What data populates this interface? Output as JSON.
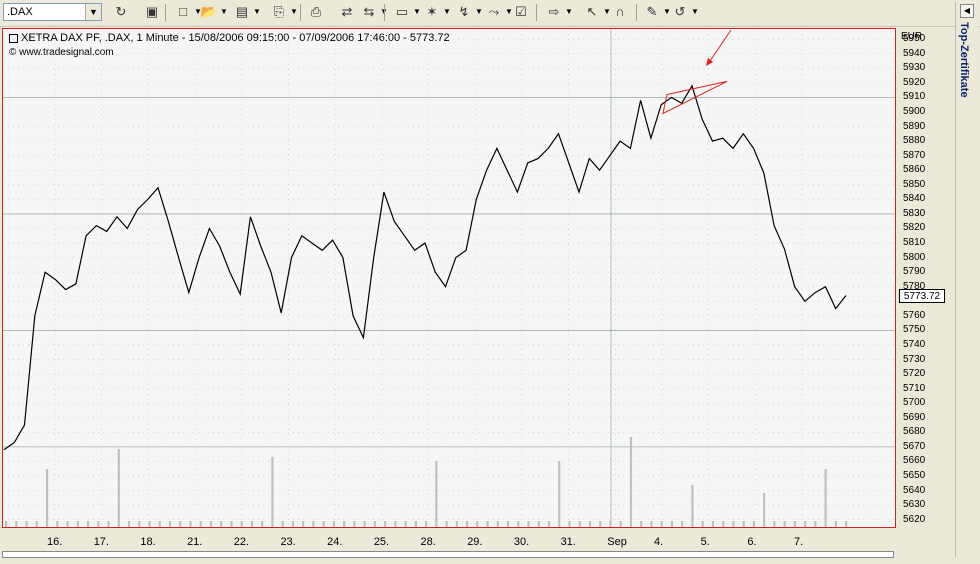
{
  "toolbar": {
    "symbol_value": ".DAX",
    "buttons": [
      {
        "name": "refresh-icon",
        "glyph": "↻"
      },
      {
        "name": "save-chart-icon",
        "glyph": "▣"
      },
      {
        "name": "new-document-icon",
        "glyph": "□"
      },
      {
        "name": "open-folder-icon",
        "glyph": "📂"
      },
      {
        "name": "disk-save-icon",
        "glyph": "▤"
      },
      {
        "name": "copy-icon",
        "glyph": "⎘"
      },
      {
        "name": "print-icon",
        "glyph": "⎙"
      },
      {
        "name": "chart-window-icon",
        "glyph": "⇄"
      },
      {
        "name": "chart-window-2-icon",
        "glyph": "⇆"
      },
      {
        "name": "display-icon",
        "glyph": "▭"
      },
      {
        "name": "indicator-icon",
        "glyph": "✶"
      },
      {
        "name": "drawing-icon",
        "glyph": "↯"
      },
      {
        "name": "trend-icon",
        "glyph": "⤳"
      },
      {
        "name": "properties-icon",
        "glyph": "☑"
      },
      {
        "name": "navigate-icon",
        "glyph": "⇨"
      },
      {
        "name": "cursor-icon",
        "glyph": "↖"
      },
      {
        "name": "magnet-icon",
        "glyph": "∩"
      },
      {
        "name": "notes-icon",
        "glyph": "✎"
      },
      {
        "name": "undo-icon",
        "glyph": "↺"
      }
    ]
  },
  "chart": {
    "title": "XETRA DAX PF, .DAX, 1 Minute - 15/08/2006 09:15:00 - 07/09/2006 17:46:00 - 5773.72",
    "copyright": "© www.tradesignal.com",
    "currency": "EUR",
    "last_value": "5773.72"
  },
  "side_panel": {
    "label": "Top-Zertifikate"
  },
  "colors": {
    "frame": "#d02020",
    "price": "#000000",
    "volume": "#c0c0c0",
    "annotation": "#e02020",
    "grid": "#9fb3a0"
  },
  "chart_data": {
    "type": "line",
    "ylim": [
      5615,
      5957
    ],
    "y_ticks": [
      5950,
      5940,
      5930,
      5920,
      5910,
      5900,
      5890,
      5880,
      5870,
      5860,
      5850,
      5840,
      5830,
      5820,
      5810,
      5800,
      5790,
      5780,
      5770,
      5760,
      5750,
      5740,
      5730,
      5720,
      5710,
      5700,
      5690,
      5680,
      5670,
      5660,
      5650,
      5640,
      5630,
      5620
    ],
    "y_tick_labels": [
      "5950",
      "5940",
      "5930",
      "5920",
      "5910",
      "5900",
      "5890",
      "5880",
      "5870",
      "5860",
      "5850",
      "5840",
      "5830",
      "5820",
      "5810",
      "5800",
      "5790",
      "5780",
      "5770",
      "5760",
      "5750",
      "5740",
      "5730",
      "5720",
      "5710",
      "5700",
      "5690",
      "5680",
      "5670",
      "5660",
      "5650",
      "5640",
      "5630",
      "5620"
    ],
    "x_labels": [
      "16.",
      "17.",
      "18.",
      "21.",
      "22.",
      "23.",
      "24.",
      "25.",
      "28.",
      "29.",
      "30.",
      "31.",
      "Sep",
      "4.",
      "5.",
      "6.",
      "7."
    ],
    "series": [
      {
        "values": [
          5668,
          5673,
          5685,
          5760,
          5790,
          5785,
          5778,
          5782,
          5815,
          5822,
          5818,
          5828,
          5820,
          5833,
          5840,
          5848,
          5825,
          5800,
          5776,
          5800,
          5820,
          5808,
          5790,
          5775,
          5828,
          5808,
          5790,
          5762,
          5800,
          5815,
          5810,
          5805,
          5812,
          5800,
          5760,
          5745,
          5800,
          5845,
          5825,
          5815,
          5805,
          5810,
          5790,
          5780,
          5800,
          5805,
          5840,
          5860,
          5875,
          5860,
          5845,
          5865,
          5868,
          5875,
          5885,
          5865,
          5845,
          5868,
          5860,
          5870,
          5880,
          5875,
          5908,
          5882,
          5905,
          5910,
          5906,
          5918,
          5895,
          5880,
          5882,
          5875,
          5885,
          5875,
          5858,
          5822,
          5806,
          5780,
          5770,
          5776,
          5780,
          5765,
          5774
        ]
      }
    ],
    "volume": [
      1,
      1,
      1,
      1,
      14,
      1,
      1,
      1,
      1,
      1,
      1,
      19,
      1,
      1,
      1,
      1,
      1,
      1,
      1,
      1,
      1,
      1,
      1,
      1,
      1,
      1,
      17,
      1,
      1,
      1,
      1,
      1,
      1,
      1,
      1,
      1,
      1,
      1,
      1,
      1,
      1,
      1,
      16,
      1,
      1,
      1,
      1,
      1,
      1,
      1,
      1,
      1,
      1,
      1,
      16,
      1,
      1,
      1,
      1,
      1,
      1,
      22,
      1,
      1,
      1,
      1,
      1,
      10,
      1,
      1,
      1,
      1,
      1,
      1,
      8,
      1,
      1,
      1,
      1,
      1,
      14,
      1,
      1
    ]
  }
}
